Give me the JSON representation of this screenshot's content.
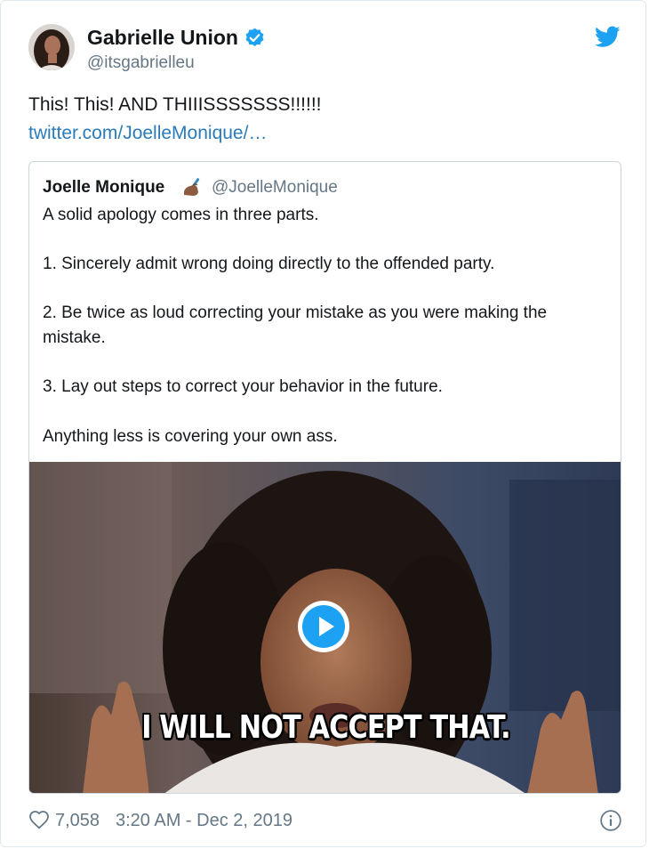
{
  "tweet": {
    "author_name": "Gabrielle Union",
    "author_handle": "@itsgabrielleu",
    "text": "This! This! AND THIIISSSSSSS!!!!!!",
    "link_text": "twitter.com/JoelleMonique/…",
    "icons": {
      "verified": "verified-badge-icon",
      "brand": "twitter-bird-icon"
    }
  },
  "quoted": {
    "author_name": "Joelle Monique",
    "author_emoji": "writing-hand-emoji",
    "author_handle": "@JoelleMonique",
    "lines": [
      "A solid apology comes in three parts.",
      "1. Sincerely admit wrong doing directly to the offended party.",
      "2. Be twice as loud correcting your mistake as you were making the",
      "mistake.",
      "3. Lay out steps to correct your behavior in the future.",
      "Anything less is covering your own ass."
    ],
    "media": {
      "caption": "I WILL NOT ACCEPT THAT.",
      "icon": "play-icon"
    }
  },
  "footer": {
    "likes": "7,058",
    "timestamp": "3:20 AM - Dec 2, 2019",
    "icons": {
      "like": "heart-icon",
      "info": "info-icon"
    }
  },
  "colors": {
    "text": "#14171a",
    "muted": "#657786",
    "link": "#2b7bb9",
    "brand_blue": "#1da1f2",
    "border": "#ccd6dd"
  }
}
